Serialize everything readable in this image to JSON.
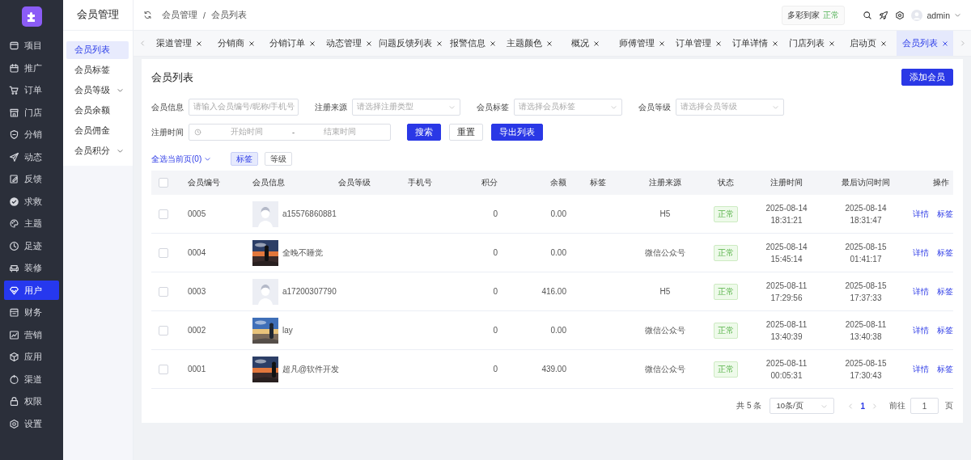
{
  "sidebar": {
    "items": [
      {
        "label": "项目",
        "selected": false
      },
      {
        "label": "推广",
        "selected": false
      },
      {
        "label": "订单",
        "selected": false
      },
      {
        "label": "门店",
        "selected": false
      },
      {
        "label": "分销",
        "selected": false
      },
      {
        "label": "动态",
        "selected": false
      },
      {
        "label": "反馈",
        "selected": false
      },
      {
        "label": "求救",
        "selected": false
      },
      {
        "label": "主题",
        "selected": false
      },
      {
        "label": "足迹",
        "selected": false
      },
      {
        "label": "装修",
        "selected": false
      },
      {
        "label": "用户",
        "selected": true
      },
      {
        "label": "财务",
        "selected": false
      },
      {
        "label": "营销",
        "selected": false
      },
      {
        "label": "应用",
        "selected": false
      },
      {
        "label": "渠道",
        "selected": false
      },
      {
        "label": "权限",
        "selected": false
      },
      {
        "label": "设置",
        "selected": false
      }
    ]
  },
  "subnav": {
    "title": "会员管理",
    "items": [
      {
        "label": "会员列表",
        "selected": true,
        "expandable": false
      },
      {
        "label": "会员标签",
        "selected": false,
        "expandable": false
      },
      {
        "label": "会员等级",
        "selected": false,
        "expandable": true
      },
      {
        "label": "会员余额",
        "selected": false,
        "expandable": false
      },
      {
        "label": "会员佣金",
        "selected": false,
        "expandable": false
      },
      {
        "label": "会员积分",
        "selected": false,
        "expandable": true
      }
    ]
  },
  "header": {
    "breadcrumb": [
      "会员管理",
      "会员列表"
    ],
    "breadcrumb_separator": "/",
    "store": {
      "name": "多彩到家",
      "status": "正常"
    },
    "user": "admin"
  },
  "tabs": [
    {
      "label": "渠道管理",
      "selected": false
    },
    {
      "label": "分销商",
      "selected": false
    },
    {
      "label": "分销订单",
      "selected": false
    },
    {
      "label": "动态管理",
      "selected": false
    },
    {
      "label": "问题反馈列表",
      "selected": false
    },
    {
      "label": "报警信息",
      "selected": false
    },
    {
      "label": "主题颜色",
      "selected": false
    },
    {
      "label": "概况",
      "selected": false
    },
    {
      "label": "师傅管理",
      "selected": false
    },
    {
      "label": "订单管理",
      "selected": false
    },
    {
      "label": "订单详情",
      "selected": false
    },
    {
      "label": "门店列表",
      "selected": false
    },
    {
      "label": "启动页",
      "selected": false
    },
    {
      "label": "会员列表",
      "selected": true
    }
  ],
  "page": {
    "title": "会员列表",
    "add_button": "添加会员",
    "filters": [
      {
        "label": "会员信息",
        "kind": "input",
        "placeholder": "请输入会员编号/昵称/手机号"
      },
      {
        "label": "注册来源",
        "kind": "select",
        "placeholder": "请选择注册类型"
      },
      {
        "label": "会员标签",
        "kind": "select",
        "placeholder": "请选择会员标签"
      },
      {
        "label": "会员等级",
        "kind": "select",
        "placeholder": "请选择会员等级"
      }
    ],
    "date_filter": {
      "label": "注册时间",
      "start_placeholder": "开始时间",
      "separator": "-",
      "end_placeholder": "结束时间"
    },
    "buttons": [
      {
        "label": "搜索",
        "kind": "primary"
      },
      {
        "label": "重置",
        "kind": "default"
      },
      {
        "label": "导出列表",
        "kind": "primary"
      }
    ],
    "select_all": "全选当前页(0)",
    "batch_buttons": [
      {
        "label": "标签",
        "selected": true
      },
      {
        "label": "等级",
        "selected": false
      }
    ],
    "table": {
      "header_checked": false,
      "columns": [
        "会员编号",
        "会员信息",
        "会员等级",
        "手机号",
        "积分",
        "余额",
        "标签",
        "注册来源",
        "状态",
        "注册时间",
        "最后访问时间",
        "操作"
      ],
      "rows": [
        {
          "checked": false,
          "id": "0005",
          "avatar": {
            "kind": "default"
          },
          "nickname": "a15576860881",
          "points": "0",
          "balance": "0.00",
          "source": "H5",
          "status": "正常",
          "registered": "2025-08-14 18:31:21",
          "last_visit": "2025-08-14 18:31:47",
          "actions": [
            "详情",
            "标签"
          ]
        },
        {
          "checked": false,
          "id": "0004",
          "avatar": {
            "kind": "picture"
          },
          "nickname": "全晚不睡觉",
          "points": "0",
          "balance": "0.00",
          "source": "微信公众号",
          "status": "正常",
          "registered": "2025-08-14 15:45:14",
          "last_visit": "2025-08-15 01:41:17",
          "actions": [
            "详情",
            "标签"
          ]
        },
        {
          "checked": false,
          "id": "0003",
          "avatar": {
            "kind": "default"
          },
          "nickname": "a17200307790",
          "points": "0",
          "balance": "416.00",
          "source": "H5",
          "status": "正常",
          "registered": "2025-08-11 17:29:56",
          "last_visit": "2025-08-15 17:37:33",
          "actions": [
            "详情",
            "标签"
          ]
        },
        {
          "checked": false,
          "id": "0002",
          "avatar": {
            "kind": "picture"
          },
          "nickname": "lay",
          "points": "0",
          "balance": "0.00",
          "source": "微信公众号",
          "status": "正常",
          "registered": "2025-08-11 13:40:39",
          "last_visit": "2025-08-11 13:40:38",
          "actions": [
            "详情",
            "标签"
          ]
        },
        {
          "checked": false,
          "id": "0001",
          "avatar": {
            "kind": "picture"
          },
          "nickname": "超凡@软件开发",
          "points": "0",
          "balance": "439.00",
          "source": "微信公众号",
          "status": "正常",
          "registered": "2025-08-11 00:05:31",
          "last_visit": "2025-08-15 17:30:43",
          "actions": [
            "详情",
            "标签"
          ]
        }
      ]
    },
    "pagination": {
      "total": "共 5 条",
      "page_size": "10条/页",
      "pages": [
        {
          "label": "1",
          "selected": true
        }
      ],
      "goto_label": "前往",
      "goto_value": "1",
      "page_suffix": "页"
    }
  }
}
